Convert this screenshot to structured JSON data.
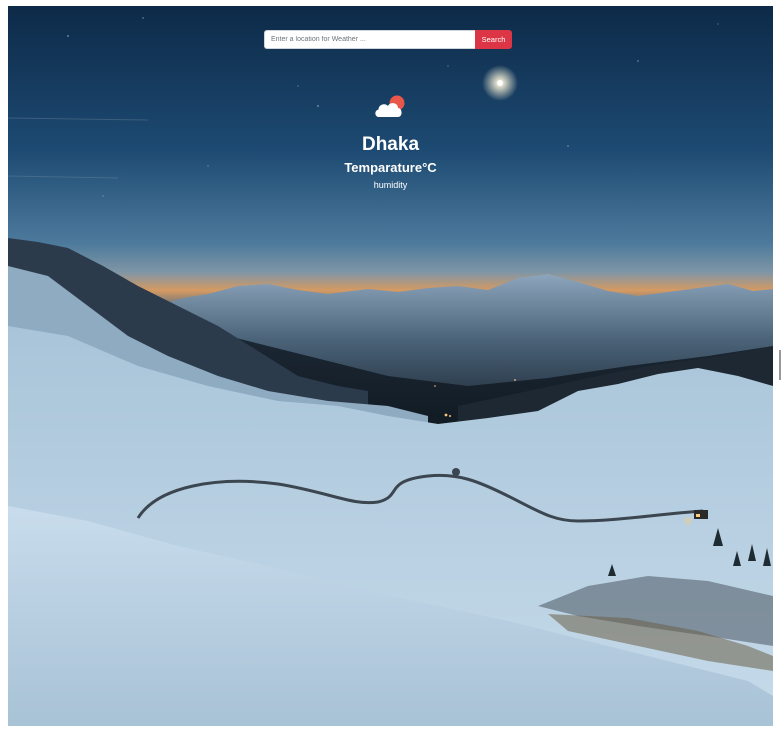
{
  "search": {
    "placeholder": "Enter a location for Weather ...",
    "button_label": "Search"
  },
  "weather": {
    "icon": "cloud-sun-icon",
    "city": "Dhaka",
    "temperature_label": "Temparature°C",
    "humidity_label": "humidity"
  },
  "colors": {
    "search_button": "#dc3545",
    "sky_top": "#0f2c4a",
    "snow": "#c9dcea"
  }
}
